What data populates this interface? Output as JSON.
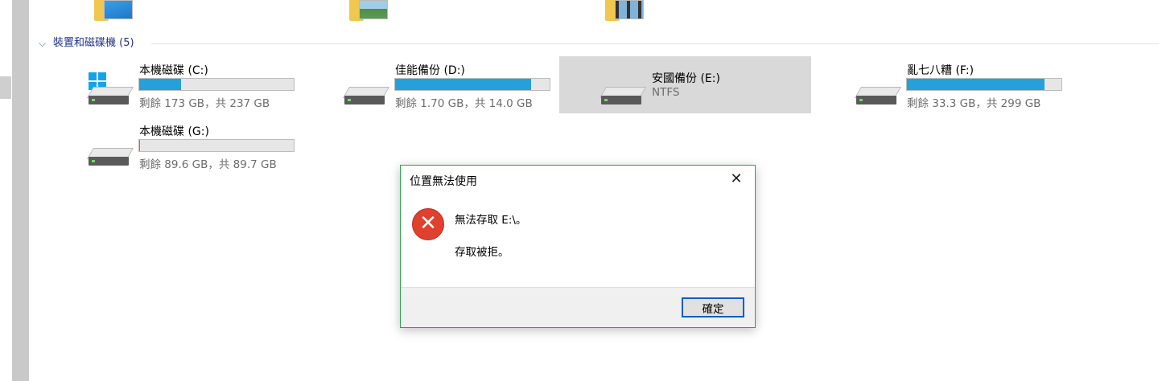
{
  "group": {
    "chevron": "⌵",
    "label": "裝置和磁碟機 (5)"
  },
  "drives": [
    {
      "name": "本機磁碟 (C:)",
      "sub": "剩餘 173 GB，共 237 GB",
      "used_fraction": 0.27,
      "icon": "windows-drive-icon"
    },
    {
      "name": "佳能備份 (D:)",
      "sub": "剩餘 1.70 GB，共 14.0 GB",
      "used_fraction": 0.88,
      "icon": "hard-drive-icon"
    },
    {
      "name": "安國備份 (E:)",
      "sub": "NTFS",
      "selected": true,
      "icon": "hard-drive-icon"
    },
    {
      "name": "亂七八糟 (F:)",
      "sub": "剩餘 33.3 GB，共 299 GB",
      "used_fraction": 0.89,
      "icon": "hard-drive-icon"
    },
    {
      "name": "本機磁碟 (G:)",
      "sub": "剩餘 89.6 GB，共 89.7 GB",
      "used_fraction": 0.001,
      "icon": "hard-drive-icon"
    }
  ],
  "dialog": {
    "title": "位置無法使用",
    "message": "無法存取 E:\\。",
    "detail": "存取被拒。",
    "ok_label": "確定",
    "close_glyph": "✕",
    "error_glyph": "✕"
  },
  "colors": {
    "accent": "#26a0da",
    "dialog_border": "#2aa64b",
    "error_red": "#e0402e",
    "selection": "#d9d9d9"
  }
}
